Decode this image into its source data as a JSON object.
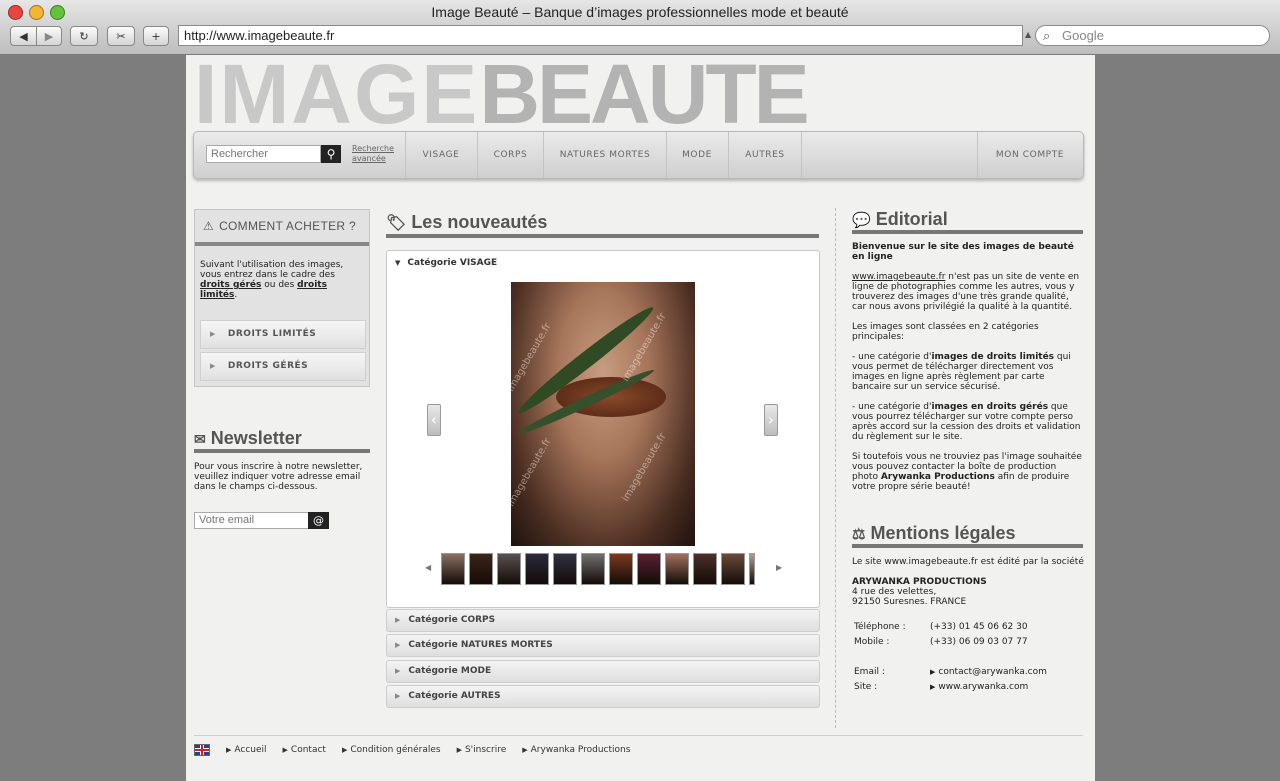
{
  "browser": {
    "title": "Image Beauté – Banque d’images professionnelles mode et beauté",
    "url": "http://www.imagebeaute.fr",
    "search_placeholder": "Google",
    "traffic_colors": [
      "#e8463f",
      "#f2b534",
      "#5fc33c"
    ]
  },
  "logo": {
    "part1": "IMAGE",
    "part2": "BEAUTE"
  },
  "nav": {
    "search_placeholder": "Rechercher",
    "advanced_line1": "Recherche",
    "advanced_line2": "avancée",
    "items": [
      "VISAGE",
      "CORPS",
      "NATURES MORTES",
      "MODE",
      "AUTRES"
    ],
    "account": "MON COMPTE"
  },
  "howto": {
    "title": "COMMENT ACHETER ?",
    "text_pre": "Suivant l'utilisation des images, vous entrez dans le cadre des ",
    "link1": "droits gérés",
    "text_mid": " ou des ",
    "link2": "droits limités",
    "text_post": ".",
    "btn_limited": "DROITS LIMITÉS",
    "btn_managed": "DROITS GÉRÉS"
  },
  "newsletter": {
    "title": "Newsletter",
    "text": "Pour vous inscrire à notre newsletter, veuillez indiquer votre adresse email dans le champs ci-dessous.",
    "placeholder": "Votre email",
    "submit": "@"
  },
  "news": {
    "title": "Les nouveautés",
    "visage_category": "Catégorie VISAGE",
    "watermark": "imagebeaute.fr",
    "thumbnail_count": 12,
    "categories": [
      "Catégorie CORPS",
      "Catégorie NATURES MORTES",
      "Catégorie MODE",
      "Catégorie AUTRES"
    ]
  },
  "editorial": {
    "title": "Editorial",
    "welcome": "Bienvenue sur le site des images de beauté en ligne",
    "site_link": "www.imagebeaute.fr",
    "p1_rest": " n'est pas un site de vente en ligne de photographies comme les autres, vous y trouverez des images d'une très grande qualité, car nous avons privilégié la qualité à la quantité.",
    "p2": "Les images sont classées en 2 catégories principales:",
    "p3_pre": "- une catégorie d'",
    "p3_bold": "images de droits limités",
    "p3_post": " qui vous permet de télécharger directement vos images en ligne après règlement par carte bancaire sur un service sécurisé.",
    "p4_pre": "- une catégorie d'",
    "p4_bold": "images en droits gérés",
    "p4_post": " que vous pourrez télécharger sur votre compte perso après accord sur la cession des droits et validation du règlement sur le site.",
    "p5_pre": "Si toutefois vous ne trouviez pas l'image souhaitée vous pouvez contacter la boîte de production photo ",
    "p5_bold": "Arywanka Productions",
    "p5_post": " afin de produire votre propre série beauté!"
  },
  "mentions": {
    "title": "Mentions légales",
    "intro": "Le site www.imagebeaute.fr est édité par la société",
    "company": "ARYWANKA PRODUCTIONS",
    "addr1": "4 rue des velettes,",
    "addr2": "92150 Suresnes. FRANCE",
    "phone_label": "Téléphone :",
    "phone": "(+33) 01 45 06 62 30",
    "mobile_label": "Mobile :",
    "mobile": "(+33) 06 09 03 07 77",
    "email_label": "Email :",
    "email": "contact@arywanka.com",
    "site_label": "Site :",
    "site": "www.arywanka.com"
  },
  "footer": {
    "links": [
      "Accueil",
      "Contact",
      "Condition générales",
      "S'inscrire",
      "Arywanka Productions"
    ]
  }
}
